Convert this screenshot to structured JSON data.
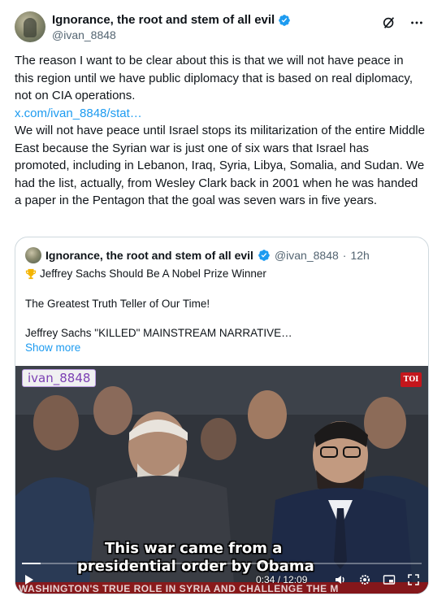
{
  "author": {
    "display_name": "Ignorance, the root and stem of all evil",
    "handle": "@ivan_8848"
  },
  "header_icons": [
    "grok-icon",
    "more-icon"
  ],
  "tweet": {
    "para1": "The reason I want to be clear about this is that we will not have peace in this region until we have public diplomacy that is based on real diplomacy, not on CIA operations.",
    "link": "x.com/ivan_8848/stat…",
    "para2": "We will not have peace until Israel stops its militarization of the entire Middle East because the Syrian war is just one of six wars that Israel has promoted, including in Lebanon, Iraq, Syria, Libya, Somalia, and Sudan. We had the list, actually, from Wesley Clark back in 2001 when he was handed a paper in the Pentagon that the goal was seven wars in five years."
  },
  "quote": {
    "display_name": "Ignorance, the root and stem of all evil",
    "handle": "@ivan_8848",
    "separator": "·",
    "time": "12h",
    "line1": "Jeffrey Sachs Should Be A Nobel Prize Winner",
    "line2": "The Greatest Truth Teller of Our Time!",
    "line3": "Jeffrey Sachs \"KILLED\" MAINSTREAM NARRATIVE…",
    "show_more": "Show more"
  },
  "video": {
    "watermark": "ivan_8848",
    "channel_logo": "TOI",
    "subtitle_line1": "This war came from a",
    "subtitle_line2": "presidential order by Obama",
    "ticker": "WASHINGTON'S TRUE ROLE IN SYRIA AND CHALLENGE THE M",
    "time": "0:34 / 12:09",
    "progress": 0.047
  },
  "colors": {
    "link": "#1d9bf0",
    "verified": "#1d9bf0",
    "secondary_text": "#536471",
    "border": "#cfd9de"
  }
}
